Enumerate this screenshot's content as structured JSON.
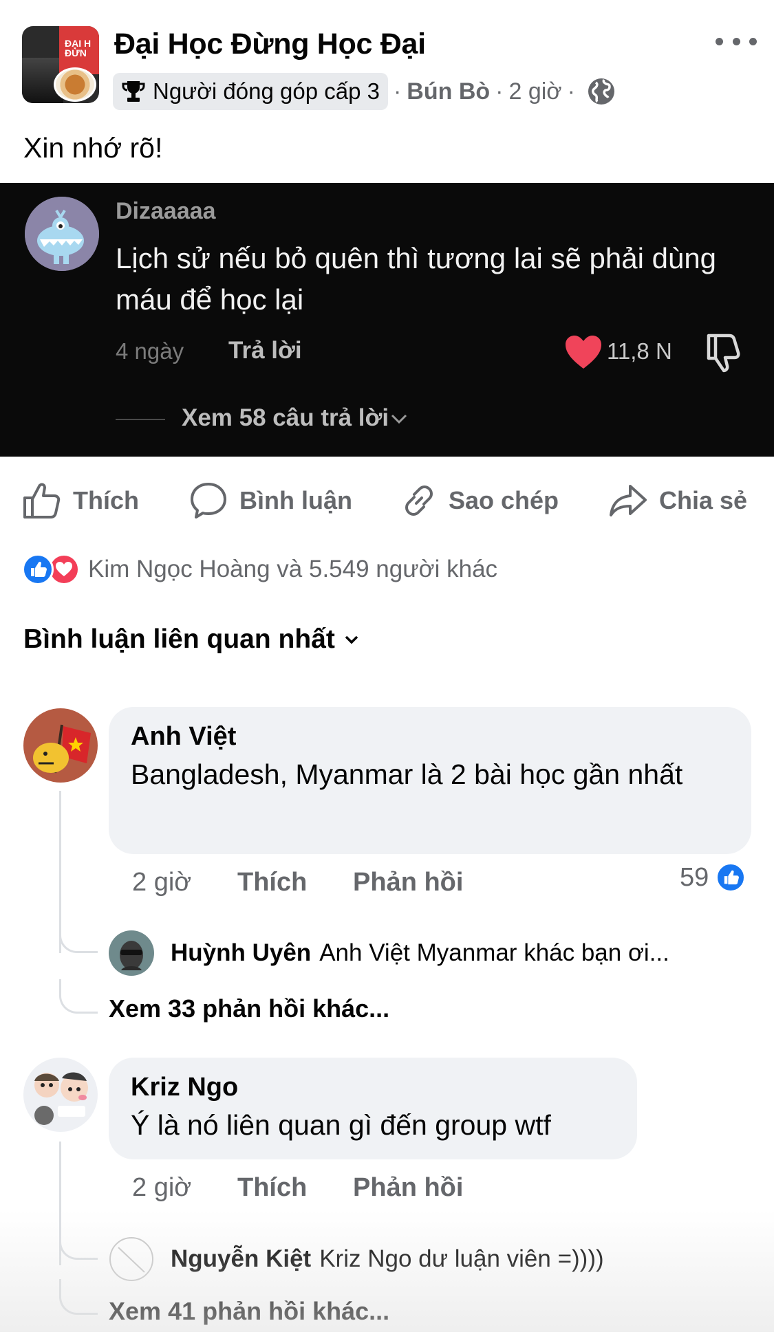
{
  "header": {
    "group_name": "Đại Học Đừng Học Đại",
    "avatar_text": "ĐẠI H ĐỪN",
    "badge": "Người đóng góp cấp 3",
    "author": "Bún Bò",
    "time": "2 giờ",
    "separator": "·",
    "icons": {
      "more": "more-dots-icon",
      "badge": "trophy-icon",
      "audience": "globe-icon"
    }
  },
  "post": {
    "text": "Xin nhớ rõ!"
  },
  "embedded_comment": {
    "name": "Dizaaaaa",
    "text": "Lịch sử nếu bỏ quên thì tương lai sẽ phải dùng máu để học lại",
    "time": "4 ngày",
    "reply_label": "Trả lời",
    "likes": "11,8 N",
    "view_replies": "Xem 58 câu trả lời",
    "colors": {
      "heart": "#f0445a",
      "background": "#0a0a0a"
    }
  },
  "actions": [
    {
      "label": "Thích",
      "icon": "like-icon"
    },
    {
      "label": "Bình luận",
      "icon": "comment-icon"
    },
    {
      "label": "Sao chép",
      "icon": "link-icon"
    },
    {
      "label": "Chia sẻ",
      "icon": "share-icon"
    }
  ],
  "reactions": {
    "text": "Kim Ngọc Hoàng và 5.549 người khác",
    "types": [
      "like",
      "love"
    ]
  },
  "sort_label": "Bình luận liên quan nhất",
  "comments": [
    {
      "name": "Anh Việt",
      "text": "Bangladesh, Myanmar là 2 bài học gần nhất",
      "time": "2 giờ",
      "like_label": "Thích",
      "reply_label": "Phản hồi",
      "like_count": "59",
      "reply": {
        "name": "Huỳnh Uyên",
        "text": "Anh Việt Myanmar khác bạn ơi..."
      },
      "more_replies": "Xem 33 phản hồi khác..."
    },
    {
      "name": "Kriz Ngo",
      "text": "Ý là nó liên quan gì đến group wtf",
      "time": "2 giờ",
      "like_label": "Thích",
      "reply_label": "Phản hồi",
      "reply": {
        "name": "Nguyễn Kiệt",
        "text": "Kriz Ngo dư luận viên =))))"
      },
      "more_replies": "Xem 41 phản hồi khác..."
    }
  ],
  "colors": {
    "facebook_blue": "#1877f2",
    "love_red": "#f33e58",
    "secondary_text": "#65676b",
    "bubble_bg": "#f0f2f5"
  }
}
